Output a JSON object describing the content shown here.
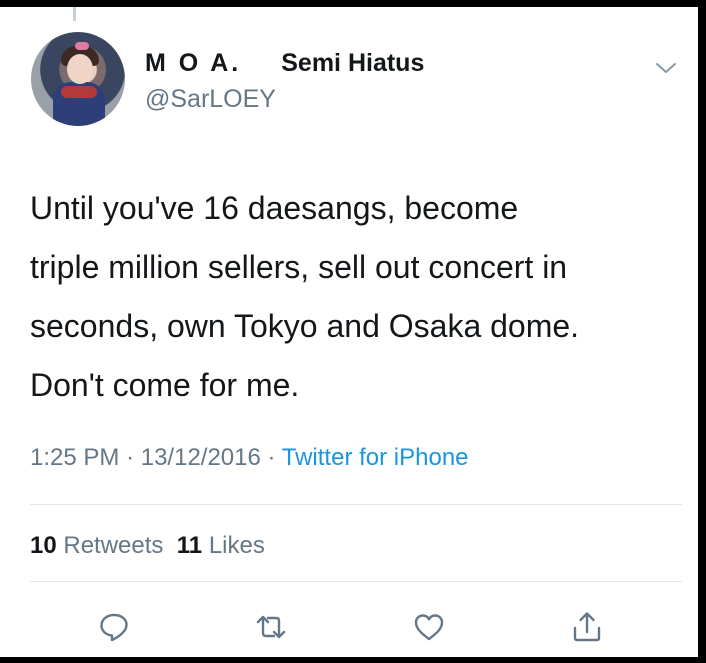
{
  "tweet": {
    "author": {
      "display_name": "M O A.",
      "status": "Semi Hiatus",
      "handle": "@SarLOEY"
    },
    "text_lines": [
      "Until you've 16 daesangs, become",
      "triple million sellers, sell out concert in",
      "seconds, own Tokyo and Osaka dome.",
      "Don't come for me."
    ],
    "time": "1:25 PM",
    "date": "13/12/2016",
    "separator": "·",
    "source": "Twitter for iPhone",
    "stats": {
      "retweets_count": "10",
      "retweets_label": "Retweets",
      "likes_count": "11",
      "likes_label": "Likes"
    },
    "actions": [
      "reply-icon",
      "retweet-icon",
      "like-icon",
      "share-icon"
    ]
  },
  "colors": {
    "text_primary": "#14171a",
    "text_secondary": "#657786",
    "link": "#1b95e0",
    "divider": "#e1e8ed"
  }
}
